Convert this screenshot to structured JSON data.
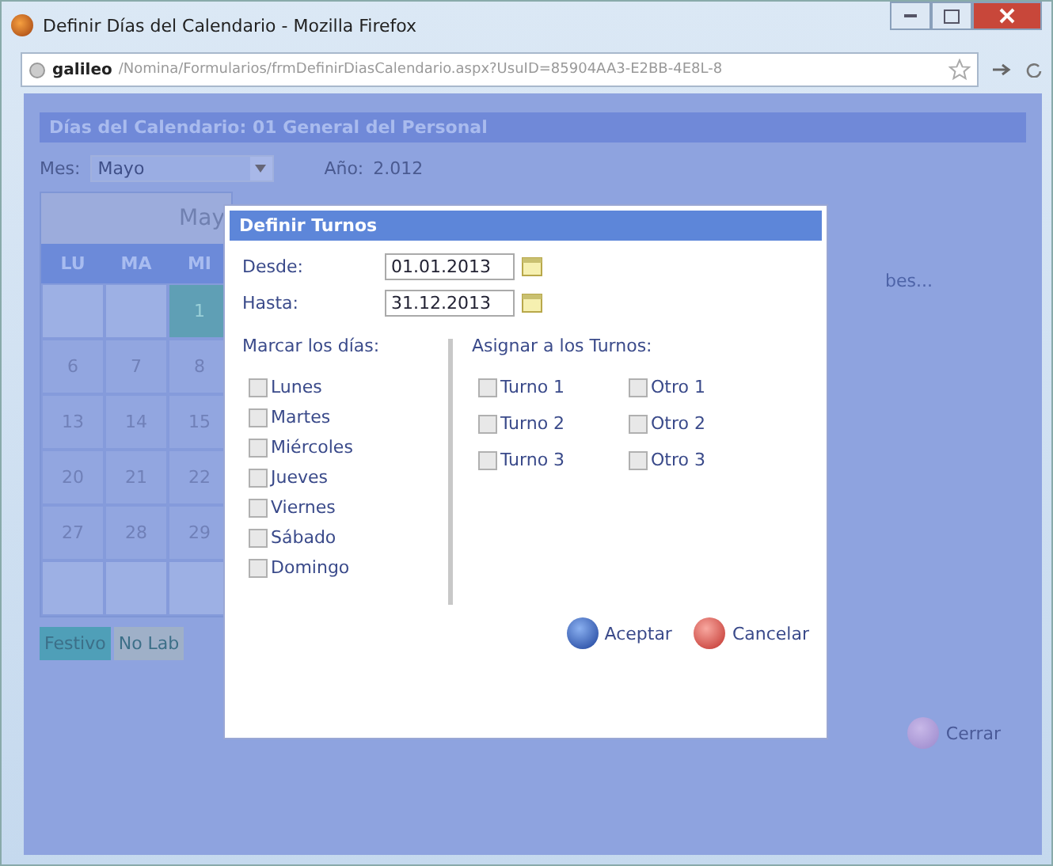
{
  "window": {
    "title": "Definir Días del Calendario - Mozilla Firefox"
  },
  "address_bar": {
    "host": "galileo",
    "path": "/Nomina/Formularios/frmDefinirDiasCalendario.aspx?UsuID=85904AA3-E2BB-4E8L-8"
  },
  "page": {
    "heading": "Días del Calendario: 01 General del Personal",
    "month_label": "Mes:",
    "month_value": "Mayo",
    "year_label": "Año:",
    "year_value": "2.012",
    "calendar_title": "May",
    "weekdays": [
      "LU",
      "MA",
      "MI"
    ],
    "weeks": [
      [
        {
          "kind": "other"
        },
        {
          "kind": "other"
        },
        {
          "kind": "festive",
          "text": "1"
        }
      ],
      [
        {
          "kind": "day",
          "text": "6"
        },
        {
          "kind": "day",
          "text": "7"
        },
        {
          "kind": "day",
          "text": "8"
        }
      ],
      [
        {
          "kind": "day",
          "text": "13"
        },
        {
          "kind": "day",
          "text": "14"
        },
        {
          "kind": "day",
          "text": "15"
        }
      ],
      [
        {
          "kind": "day",
          "text": "20"
        },
        {
          "kind": "day",
          "text": "21"
        },
        {
          "kind": "day",
          "text": "22"
        }
      ],
      [
        {
          "kind": "day",
          "text": "27"
        },
        {
          "kind": "day",
          "text": "28"
        },
        {
          "kind": "day",
          "text": "29"
        }
      ],
      [
        {
          "kind": "other"
        },
        {
          "kind": "other"
        },
        {
          "kind": "other"
        }
      ]
    ],
    "side_link": "bes...",
    "legend": [
      {
        "label": "Festivo",
        "color": "#4f9fb8"
      },
      {
        "label": "No Lab",
        "color": "#9fb0c8"
      }
    ],
    "close_button": "Cerrar"
  },
  "dialog": {
    "title": "Definir Turnos",
    "from_label": "Desde:",
    "from_value": "01.01.2013",
    "to_label": "Hasta:",
    "to_value": "31.12.2013",
    "days_heading": "Marcar los días:",
    "days": [
      {
        "label": "Lunes",
        "checked": false
      },
      {
        "label": "Martes",
        "checked": false
      },
      {
        "label": "Miércoles",
        "checked": false
      },
      {
        "label": "Jueves",
        "checked": false
      },
      {
        "label": "Viernes",
        "checked": false
      },
      {
        "label": "Sábado",
        "checked": false
      },
      {
        "label": "Domingo",
        "checked": false
      }
    ],
    "shifts_heading": "Asignar a los Turnos:",
    "shifts": [
      {
        "label": "Turno 1",
        "checked": false
      },
      {
        "label": "Otro 1",
        "checked": false
      },
      {
        "label": "Turno 2",
        "checked": false
      },
      {
        "label": "Otro 2",
        "checked": false
      },
      {
        "label": "Turno 3",
        "checked": false
      },
      {
        "label": "Otro 3",
        "checked": false
      }
    ],
    "accept": "Aceptar",
    "cancel": "Cancelar"
  }
}
